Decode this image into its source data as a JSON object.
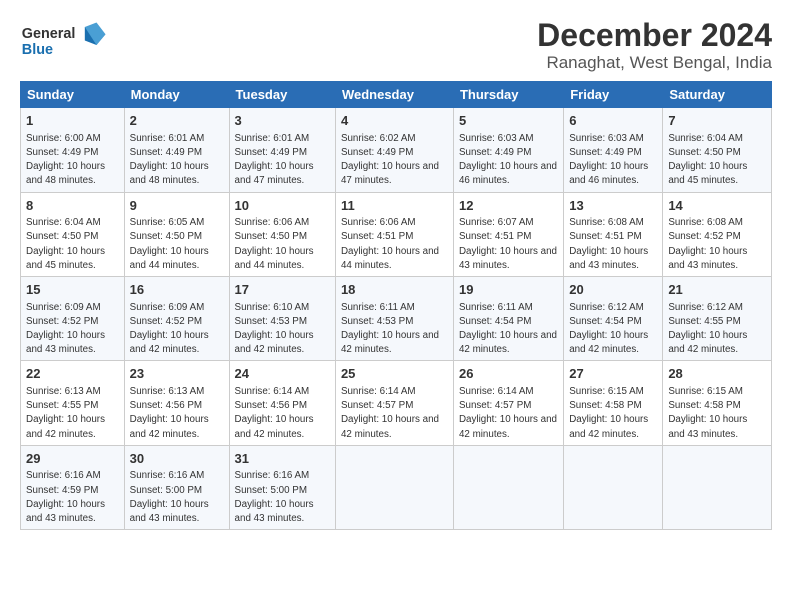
{
  "header": {
    "logo_general": "General",
    "logo_blue": "Blue",
    "title": "December 2024",
    "subtitle": "Ranaghat, West Bengal, India"
  },
  "columns": [
    "Sunday",
    "Monday",
    "Tuesday",
    "Wednesday",
    "Thursday",
    "Friday",
    "Saturday"
  ],
  "weeks": [
    [
      {
        "day": "1",
        "sunrise": "Sunrise: 6:00 AM",
        "sunset": "Sunset: 4:49 PM",
        "daylight": "Daylight: 10 hours and 48 minutes."
      },
      {
        "day": "2",
        "sunrise": "Sunrise: 6:01 AM",
        "sunset": "Sunset: 4:49 PM",
        "daylight": "Daylight: 10 hours and 48 minutes."
      },
      {
        "day": "3",
        "sunrise": "Sunrise: 6:01 AM",
        "sunset": "Sunset: 4:49 PM",
        "daylight": "Daylight: 10 hours and 47 minutes."
      },
      {
        "day": "4",
        "sunrise": "Sunrise: 6:02 AM",
        "sunset": "Sunset: 4:49 PM",
        "daylight": "Daylight: 10 hours and 47 minutes."
      },
      {
        "day": "5",
        "sunrise": "Sunrise: 6:03 AM",
        "sunset": "Sunset: 4:49 PM",
        "daylight": "Daylight: 10 hours and 46 minutes."
      },
      {
        "day": "6",
        "sunrise": "Sunrise: 6:03 AM",
        "sunset": "Sunset: 4:49 PM",
        "daylight": "Daylight: 10 hours and 46 minutes."
      },
      {
        "day": "7",
        "sunrise": "Sunrise: 6:04 AM",
        "sunset": "Sunset: 4:50 PM",
        "daylight": "Daylight: 10 hours and 45 minutes."
      }
    ],
    [
      {
        "day": "8",
        "sunrise": "Sunrise: 6:04 AM",
        "sunset": "Sunset: 4:50 PM",
        "daylight": "Daylight: 10 hours and 45 minutes."
      },
      {
        "day": "9",
        "sunrise": "Sunrise: 6:05 AM",
        "sunset": "Sunset: 4:50 PM",
        "daylight": "Daylight: 10 hours and 44 minutes."
      },
      {
        "day": "10",
        "sunrise": "Sunrise: 6:06 AM",
        "sunset": "Sunset: 4:50 PM",
        "daylight": "Daylight: 10 hours and 44 minutes."
      },
      {
        "day": "11",
        "sunrise": "Sunrise: 6:06 AM",
        "sunset": "Sunset: 4:51 PM",
        "daylight": "Daylight: 10 hours and 44 minutes."
      },
      {
        "day": "12",
        "sunrise": "Sunrise: 6:07 AM",
        "sunset": "Sunset: 4:51 PM",
        "daylight": "Daylight: 10 hours and 43 minutes."
      },
      {
        "day": "13",
        "sunrise": "Sunrise: 6:08 AM",
        "sunset": "Sunset: 4:51 PM",
        "daylight": "Daylight: 10 hours and 43 minutes."
      },
      {
        "day": "14",
        "sunrise": "Sunrise: 6:08 AM",
        "sunset": "Sunset: 4:52 PM",
        "daylight": "Daylight: 10 hours and 43 minutes."
      }
    ],
    [
      {
        "day": "15",
        "sunrise": "Sunrise: 6:09 AM",
        "sunset": "Sunset: 4:52 PM",
        "daylight": "Daylight: 10 hours and 43 minutes."
      },
      {
        "day": "16",
        "sunrise": "Sunrise: 6:09 AM",
        "sunset": "Sunset: 4:52 PM",
        "daylight": "Daylight: 10 hours and 42 minutes."
      },
      {
        "day": "17",
        "sunrise": "Sunrise: 6:10 AM",
        "sunset": "Sunset: 4:53 PM",
        "daylight": "Daylight: 10 hours and 42 minutes."
      },
      {
        "day": "18",
        "sunrise": "Sunrise: 6:11 AM",
        "sunset": "Sunset: 4:53 PM",
        "daylight": "Daylight: 10 hours and 42 minutes."
      },
      {
        "day": "19",
        "sunrise": "Sunrise: 6:11 AM",
        "sunset": "Sunset: 4:54 PM",
        "daylight": "Daylight: 10 hours and 42 minutes."
      },
      {
        "day": "20",
        "sunrise": "Sunrise: 6:12 AM",
        "sunset": "Sunset: 4:54 PM",
        "daylight": "Daylight: 10 hours and 42 minutes."
      },
      {
        "day": "21",
        "sunrise": "Sunrise: 6:12 AM",
        "sunset": "Sunset: 4:55 PM",
        "daylight": "Daylight: 10 hours and 42 minutes."
      }
    ],
    [
      {
        "day": "22",
        "sunrise": "Sunrise: 6:13 AM",
        "sunset": "Sunset: 4:55 PM",
        "daylight": "Daylight: 10 hours and 42 minutes."
      },
      {
        "day": "23",
        "sunrise": "Sunrise: 6:13 AM",
        "sunset": "Sunset: 4:56 PM",
        "daylight": "Daylight: 10 hours and 42 minutes."
      },
      {
        "day": "24",
        "sunrise": "Sunrise: 6:14 AM",
        "sunset": "Sunset: 4:56 PM",
        "daylight": "Daylight: 10 hours and 42 minutes."
      },
      {
        "day": "25",
        "sunrise": "Sunrise: 6:14 AM",
        "sunset": "Sunset: 4:57 PM",
        "daylight": "Daylight: 10 hours and 42 minutes."
      },
      {
        "day": "26",
        "sunrise": "Sunrise: 6:14 AM",
        "sunset": "Sunset: 4:57 PM",
        "daylight": "Daylight: 10 hours and 42 minutes."
      },
      {
        "day": "27",
        "sunrise": "Sunrise: 6:15 AM",
        "sunset": "Sunset: 4:58 PM",
        "daylight": "Daylight: 10 hours and 42 minutes."
      },
      {
        "day": "28",
        "sunrise": "Sunrise: 6:15 AM",
        "sunset": "Sunset: 4:58 PM",
        "daylight": "Daylight: 10 hours and 43 minutes."
      }
    ],
    [
      {
        "day": "29",
        "sunrise": "Sunrise: 6:16 AM",
        "sunset": "Sunset: 4:59 PM",
        "daylight": "Daylight: 10 hours and 43 minutes."
      },
      {
        "day": "30",
        "sunrise": "Sunrise: 6:16 AM",
        "sunset": "Sunset: 5:00 PM",
        "daylight": "Daylight: 10 hours and 43 minutes."
      },
      {
        "day": "31",
        "sunrise": "Sunrise: 6:16 AM",
        "sunset": "Sunset: 5:00 PM",
        "daylight": "Daylight: 10 hours and 43 minutes."
      },
      null,
      null,
      null,
      null
    ]
  ]
}
